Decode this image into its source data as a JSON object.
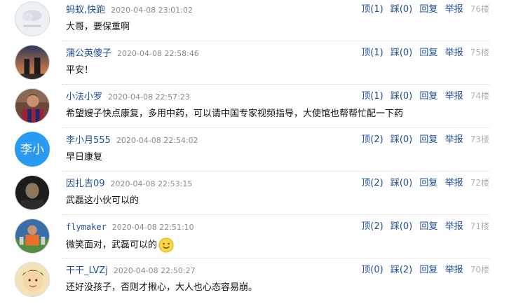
{
  "actions": {
    "up": "顶",
    "down": "踩",
    "reply": "回复",
    "report": "举报"
  },
  "comments": [
    {
      "user": "蚂蚁,快跑",
      "time": "2020-04-08 23:01:02",
      "content": "大哥，要保重啊",
      "up": "(1)",
      "down": "(0)",
      "floor": "76楼",
      "avatar": "cloud-avatar"
    },
    {
      "user": "蒲公英傻子",
      "time": "2020-04-08 22:58:46",
      "content": "平安！",
      "up": "(1)",
      "down": "(0)",
      "floor": "75楼",
      "avatar": "sunset-buildings-avatar"
    },
    {
      "user": "小法小罗",
      "time": "2020-04-08 22:57:23",
      "content": "希望嫂子快点康复，多用中药，可以请中国专家视频指导，大使馆也帮帮忙配一下药",
      "up": "(1)",
      "down": "(0)",
      "floor": "74楼",
      "avatar": "soccer-player-avatar"
    },
    {
      "user": "李小月555",
      "time": "2020-04-08 22:54:02",
      "content": "早日康复",
      "up": "(2)",
      "down": "(0)",
      "floor": "73楼",
      "avatar": "text-avatar",
      "avatar_text": "李小",
      "avatar_color": "#2b9af3"
    },
    {
      "user": "因扎吉09",
      "time": "2020-04-08 22:53:15",
      "content": "武磊这小伙可以的",
      "up": "(2)",
      "down": "(0)",
      "floor": "72楼",
      "avatar": "portrait-avatar"
    },
    {
      "user": "flymaker",
      "time": "2020-04-08 22:51:10",
      "content": "微笑面对，武磊可以的",
      "up": "(2)",
      "down": "(0)",
      "floor": "71楼",
      "avatar": "team-player-avatar",
      "emoji": "smiley-icon"
    },
    {
      "user": "干干_LVZj",
      "time": "2020-04-08 22:50:27",
      "content": "还好没孩子，否则才揪心，大人也心态容易崩。",
      "up": "(0)",
      "down": "(2)",
      "floor": "70楼",
      "avatar": "cartoon-face-avatar"
    }
  ]
}
